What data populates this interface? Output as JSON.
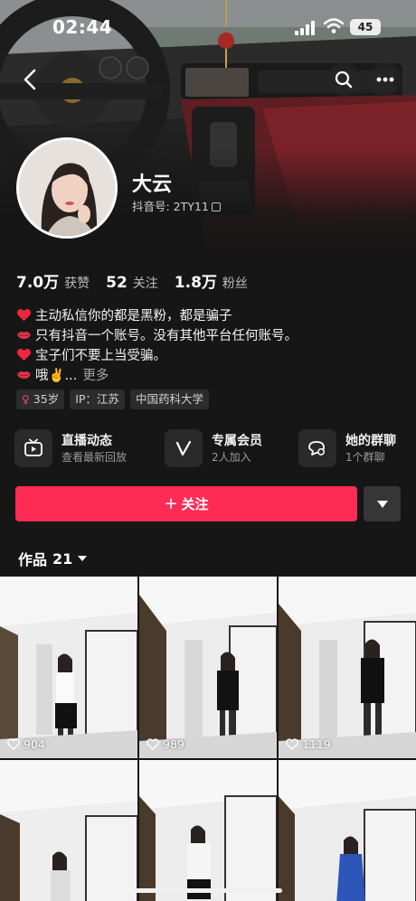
{
  "status_bar": {
    "time": "02:44",
    "battery": "45"
  },
  "profile": {
    "nickname": "大云",
    "douyin_id": "抖音号: 2TY11"
  },
  "stats": [
    {
      "value": "7.0万",
      "label": "获赞"
    },
    {
      "value": "52",
      "label": "关注"
    },
    {
      "value": "1.8万",
      "label": "粉丝"
    }
  ],
  "bio": {
    "lines": [
      {
        "icon": "heart-icon",
        "text": "主动私信你的都是黑粉，都是骗子"
      },
      {
        "icon": "lips-icon",
        "text": "只有抖音一个账号。没有其他平台任何账号。"
      },
      {
        "icon": "heart-icon",
        "text": "宝子们不要上当受骗。"
      },
      {
        "icon": "lips-icon",
        "text": "哦✌️..."
      }
    ],
    "more": "更多"
  },
  "tags": [
    {
      "icon": "female-icon",
      "text": "35岁"
    },
    {
      "text": "IP：江苏"
    },
    {
      "text": "中国药科大学"
    }
  ],
  "features": [
    {
      "icon": "live-tv-icon",
      "title": "直播动态",
      "subtitle": "查看最新回放"
    },
    {
      "icon": "vip-v-icon",
      "title": "专属会员",
      "subtitle": "2人加入"
    },
    {
      "icon": "group-chat-icon",
      "title": "她的群聊",
      "subtitle": "1个群聊"
    }
  ],
  "actions": {
    "follow": "关注"
  },
  "works": {
    "title": "作品",
    "count": "21",
    "videos": [
      {
        "likes": "904"
      },
      {
        "likes": "989"
      },
      {
        "likes": "1119"
      },
      {
        "likes": ""
      },
      {
        "likes": ""
      },
      {
        "likes": ""
      }
    ]
  },
  "colors": {
    "accent": "#fe2c55",
    "background": "#161616",
    "card": "#2a2a2a"
  }
}
